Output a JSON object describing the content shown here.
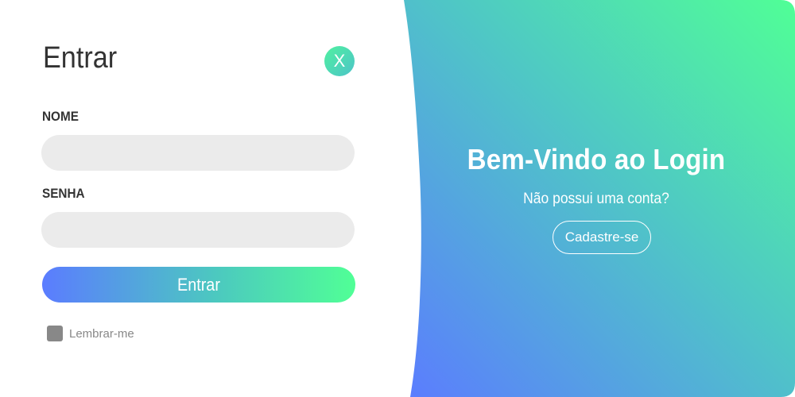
{
  "form": {
    "title": "Entrar",
    "close_label": "X",
    "name_label": "NOME",
    "name_value": "",
    "password_label": "SENHA",
    "password_value": "",
    "submit_label": "Entrar",
    "remember_label": "Lembrar-me",
    "remember_checked": false
  },
  "welcome": {
    "title": "Bem-Vindo ao Login",
    "subtitle": "Não possui uma conta?",
    "signup_label": "Cadastre-se"
  },
  "colors": {
    "gradient_start": "#5b7cff",
    "gradient_mid": "#4cc8c0",
    "gradient_end": "#50ff96",
    "text_dark": "#333333",
    "input_bg": "#ebebeb",
    "checkbox": "#888888"
  }
}
